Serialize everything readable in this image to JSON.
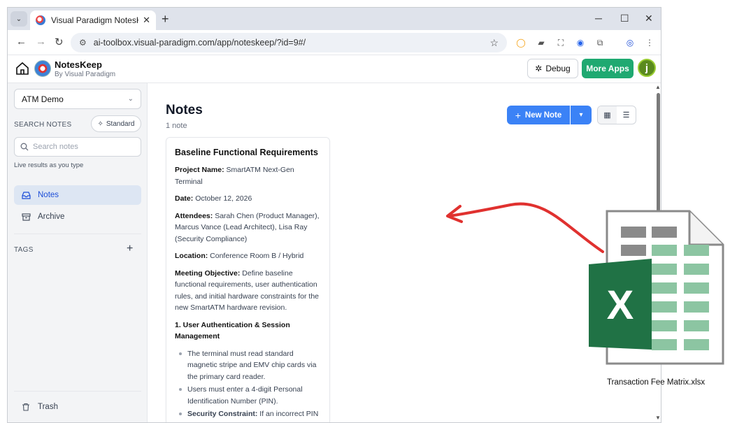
{
  "browser": {
    "tab_title": "Visual Paradigm NotesKeep: AI",
    "tab_close": "✕",
    "new_tab": "+",
    "url": "ai-toolbox.visual-paradigm.com/app/noteskeep/?id=9#/",
    "window_controls": {
      "minimize": "─",
      "maximize": "☐",
      "close": "✕"
    }
  },
  "app": {
    "name": "NotesKeep",
    "by": "By Visual Paradigm",
    "debug_label": "Debug",
    "more_apps_label": "More Apps",
    "avatar_initial": "j",
    "accent": "#3b82f6",
    "more_apps_color": "#1fa971"
  },
  "sidebar": {
    "notebook": "ATM Demo",
    "search_label": "SEARCH NOTES",
    "mode_button": "Standard",
    "search_placeholder": "Search notes",
    "hint": "Live results as you type",
    "items": [
      {
        "label": "Notes",
        "icon": "inbox-icon",
        "active": true
      },
      {
        "label": "Archive",
        "icon": "archive-icon",
        "active": false
      }
    ],
    "tags_label": "TAGS",
    "tags_add": "+",
    "trash_label": "Trash"
  },
  "main": {
    "title": "Notes",
    "count": "1 note",
    "new_note_label": "New Note"
  },
  "note": {
    "title": "Baseline Functional Requirements",
    "project_label": "Project Name:",
    "project_value": "SmartATM Next-Gen Terminal",
    "date_label": "Date:",
    "date_value": "October 12, 2026",
    "attendees_label": "Attendees:",
    "attendees_value": "Sarah Chen (Product Manager), Marcus Vance (Lead Architect), Lisa Ray (Security Compliance)",
    "location_label": "Location:",
    "location_value": "Conference Room B / Hybrid",
    "objective_label": "Meeting Objective:",
    "objective_value": "Define baseline functional requirements, user authentication rules, and initial hardware constraints for the new SmartATM hardware revision.",
    "section1": "1. User Authentication & Session Management",
    "bullets": [
      "The terminal must read standard magnetic stripe and EMV chip cards via the primary card reader.",
      "Users must enter a 4-digit Personal Identification Number (PIN)."
    ],
    "constraint_label": "Security Constraint:",
    "constraint_value": "If an incorrect PIN"
  },
  "overlay": {
    "file_caption": "Transaction Fee Matrix.xlsx",
    "file_icon": "excel-file-icon",
    "excel_letter": "X",
    "arrow_color": "#e0312f"
  }
}
